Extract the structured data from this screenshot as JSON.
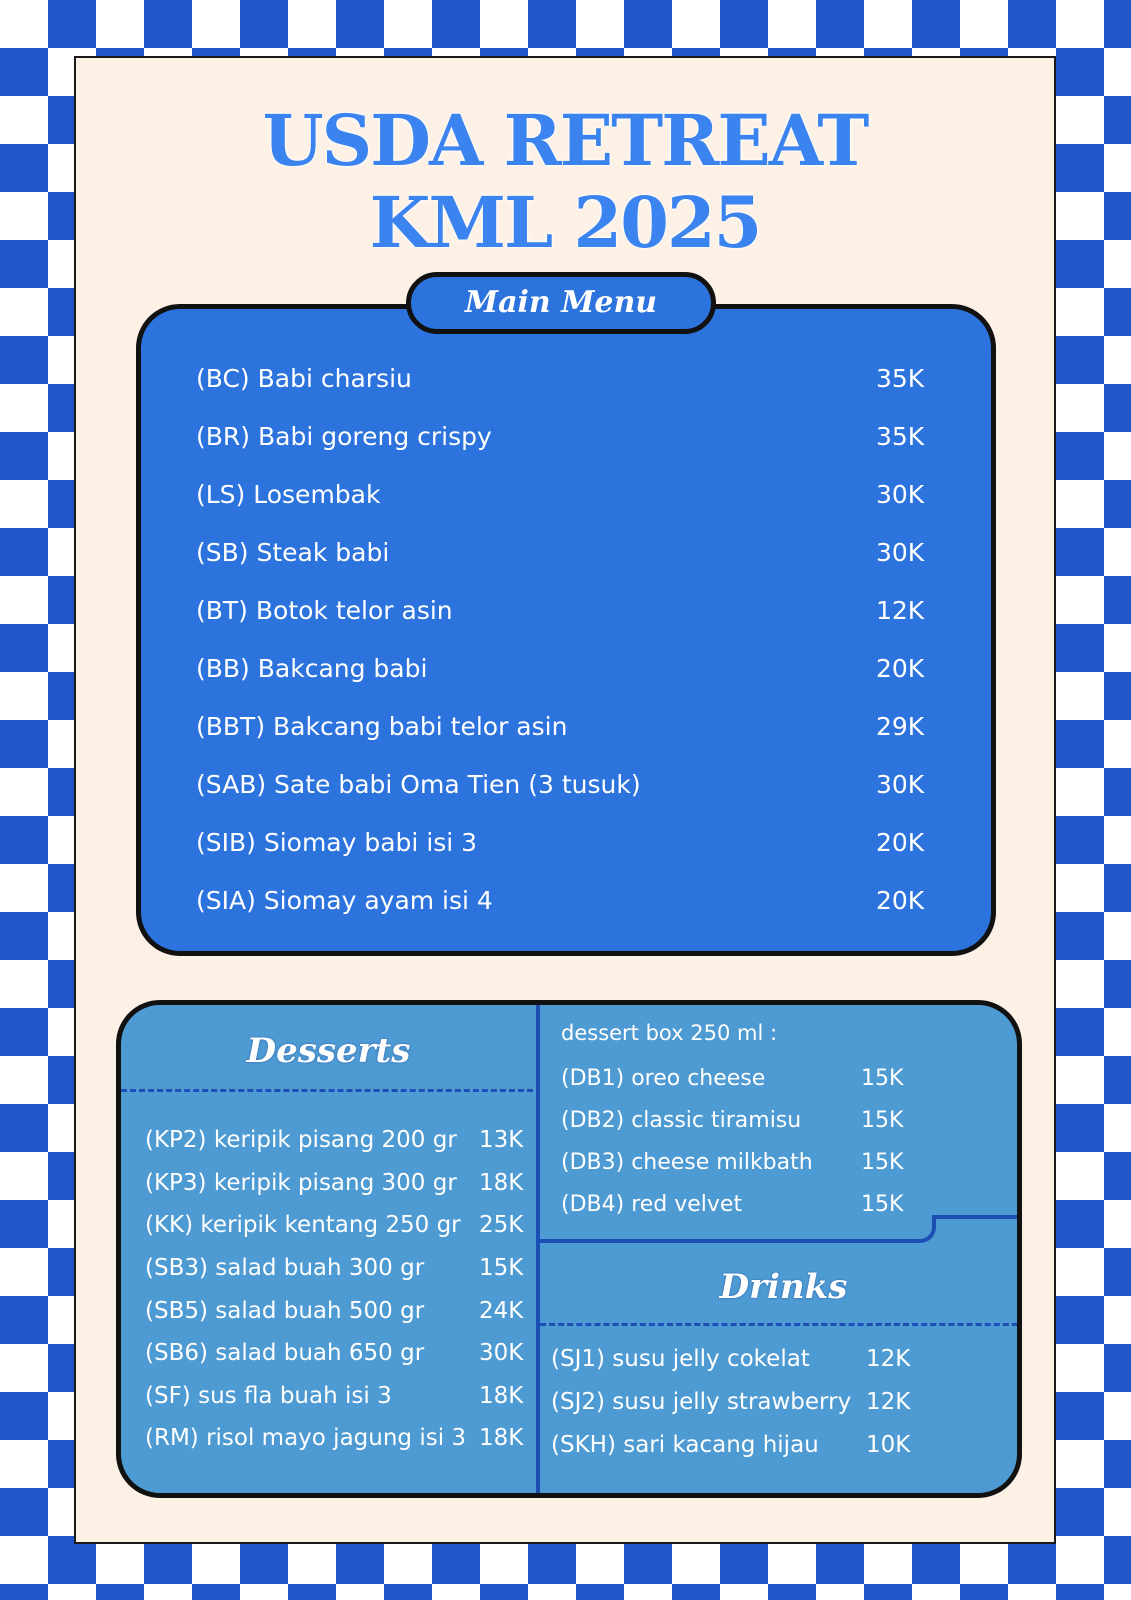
{
  "title": {
    "line1": "USDA RETREAT",
    "line2": "KML 2025"
  },
  "main_menu": {
    "label": "Main Menu",
    "items": [
      {
        "name": "(BC) Babi charsiu",
        "price": "35K"
      },
      {
        "name": "(BR) Babi goreng crispy",
        "price": "35K"
      },
      {
        "name": "(LS) Losembak",
        "price": "30K"
      },
      {
        "name": "(SB) Steak babi",
        "price": "30K"
      },
      {
        "name": "(BT) Botok telor asin",
        "price": "12K"
      },
      {
        "name": "(BB) Bakcang babi",
        "price": "20K"
      },
      {
        "name": "(BBT) Bakcang babi telor asin",
        "price": "29K"
      },
      {
        "name": "(SAB) Sate babi Oma Tien (3 tusuk)",
        "price": "30K"
      },
      {
        "name": "(SIB) Siomay babi isi 3",
        "price": "20K"
      },
      {
        "name": "(SIA) Siomay ayam isi 4",
        "price": "20K"
      }
    ]
  },
  "desserts": {
    "label": "Desserts",
    "items": [
      {
        "name": "(KP2) keripik pisang 200 gr",
        "price": "13K"
      },
      {
        "name": "(KP3) keripik pisang 300 gr",
        "price": "18K"
      },
      {
        "name": "(KK) keripik kentang 250 gr",
        "price": "25K"
      },
      {
        "name": "(SB3) salad buah 300 gr",
        "price": "15K"
      },
      {
        "name": "(SB5) salad buah 500 gr",
        "price": "24K"
      },
      {
        "name": "(SB6) salad buah 650 gr",
        "price": "30K"
      },
      {
        "name": "(SF) sus fla buah isi 3",
        "price": "18K"
      },
      {
        "name": "(RM) risol mayo jagung isi 3",
        "price": "18K"
      }
    ]
  },
  "dessert_box": {
    "intro": "dessert box 250 ml :",
    "items": [
      {
        "name": "(DB1) oreo cheese",
        "price": "15K"
      },
      {
        "name": "(DB2) classic tiramisu",
        "price": "15K"
      },
      {
        "name": "(DB3) cheese milkbath",
        "price": "15K"
      },
      {
        "name": "(DB4) red velvet",
        "price": "15K"
      }
    ]
  },
  "drinks": {
    "label": "Drinks",
    "items": [
      {
        "name": "(SJ1) susu jelly cokelat",
        "price": "12K"
      },
      {
        "name": "(SJ2) susu jelly strawberry",
        "price": "12K"
      },
      {
        "name": "(SKH) sari kacang hijau",
        "price": "10K"
      }
    ]
  },
  "colors": {
    "checker_blue": "#1f55c7",
    "card_bg": "#fdf1e6",
    "title_blue": "#3b84f0",
    "main_box": "#2c73dd",
    "bottom_box": "#4e9ad2"
  }
}
